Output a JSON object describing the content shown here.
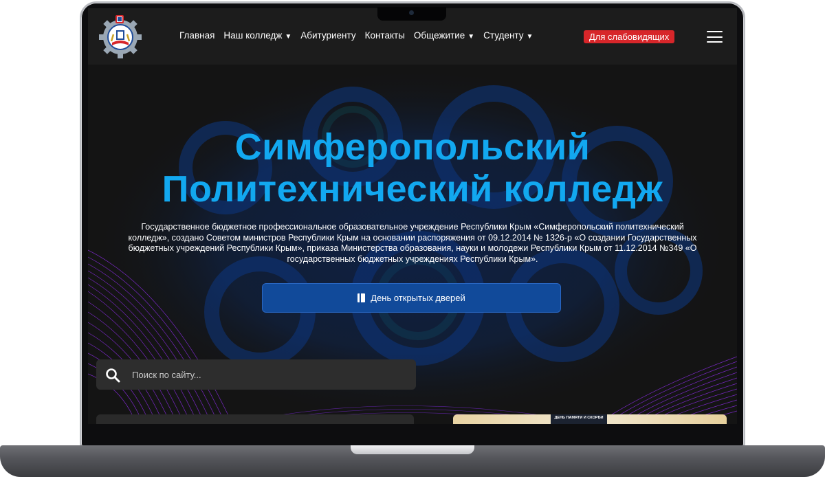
{
  "header": {
    "logo_alt": "college-emblem",
    "nav": [
      {
        "label": "Главная",
        "has_dropdown": false
      },
      {
        "label": "Наш колледж",
        "has_dropdown": true
      },
      {
        "label": "Абитуриенту",
        "has_dropdown": false
      },
      {
        "label": "Контакты",
        "has_dropdown": false
      },
      {
        "label": "Общежитие",
        "has_dropdown": true
      },
      {
        "label": "Студенту",
        "has_dropdown": true
      }
    ],
    "accessibility_label": "Для слабовидящих",
    "menu_icon": "hamburger-menu-icon"
  },
  "hero": {
    "title_line1": "Симферопольский",
    "title_line2": "Политехнический колледж",
    "description": "Государственное бюджетное профессиональное образовательное учреждение Республики Крым «Симферопольский политехнический колледж», создано Советом министров Республики Крым на основании распоряжения от 09.12.2014 № 1326-р «О создании Государственных бюджетных учреждений Республики Крым», приказа Министерства образования, науки и молодежи Республики Крым от 11.12.2014 №349 «О государственных бюджетных учреждениях Республики Крым».",
    "open_day_button": "День открытых дверей",
    "button_icon": "book-icon"
  },
  "search": {
    "placeholder": "Поиск по сайту...",
    "icon": "search-icon"
  },
  "news_preview": {
    "thumb_text": "ДЕНЬ ПАМЯТИ И СКОРБИ"
  },
  "colors": {
    "title_blue": "#12a8f0",
    "button_blue": "#114a9a",
    "accent_red": "#d7262a",
    "background": "#161616"
  }
}
